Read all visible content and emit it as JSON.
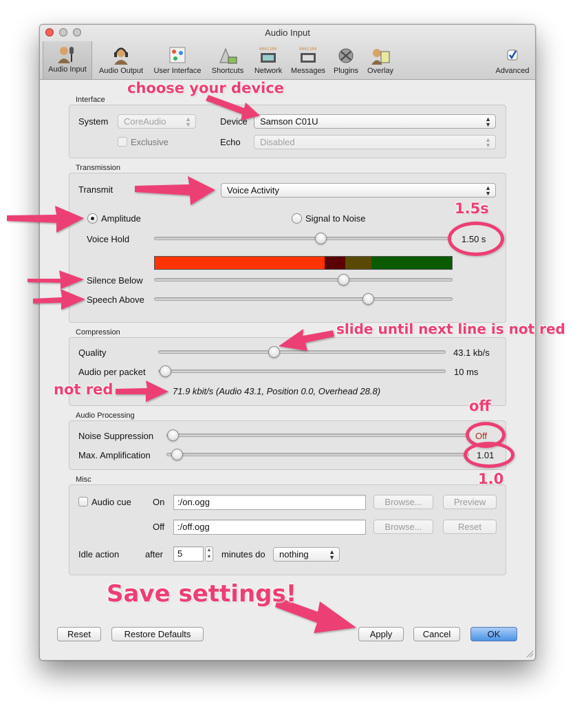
{
  "window": {
    "title": "Audio Input"
  },
  "toolbar": {
    "items": [
      {
        "label": "Audio Input",
        "icon": "microphone-person-icon"
      },
      {
        "label": "Audio Output",
        "icon": "headphones-person-icon"
      },
      {
        "label": "User Interface",
        "icon": "interface-icon"
      },
      {
        "label": "Shortcuts",
        "icon": "keyboard-icon"
      },
      {
        "label": "Network",
        "icon": "network-icon"
      },
      {
        "label": "Messages",
        "icon": "messages-icon"
      },
      {
        "label": "Plugins",
        "icon": "plugin-icon"
      },
      {
        "label": "Overlay",
        "icon": "overlay-icon"
      }
    ],
    "advanced_label": "Advanced",
    "advanced_checked": true
  },
  "interface": {
    "group_label": "Interface",
    "system_label": "System",
    "system_value": "CoreAudio",
    "exclusive_label": "Exclusive",
    "device_label": "Device",
    "device_value": "Samson C01U",
    "echo_label": "Echo",
    "echo_value": "Disabled"
  },
  "transmission": {
    "group_label": "Transmission",
    "transmit_label": "Transmit",
    "transmit_value": "Voice Activity",
    "amplitude_label": "Amplitude",
    "snr_label": "Signal to Noise",
    "voice_hold_label": "Voice Hold",
    "voice_hold_value": "1.50 s",
    "silence_below_label": "Silence Below",
    "speech_above_label": "Speech Above",
    "meter_colors": [
      "#ff3300",
      "#5a0000",
      "#5a4a00",
      "#0a5a00"
    ]
  },
  "compression": {
    "group_label": "Compression",
    "quality_label": "Quality",
    "quality_value": "43.1 kb/s",
    "audio_per_packet_label": "Audio per packet",
    "audio_per_packet_value": "10 ms",
    "bitrate_info": "71.9 kbit/s (Audio 43.1, Position 0.0, Overhead 28.8)"
  },
  "audio_processing": {
    "group_label": "Audio Processing",
    "noise_suppression_label": "Noise Suppression",
    "noise_suppression_value": "Off",
    "max_amp_label": "Max. Amplification",
    "max_amp_value": "1.01"
  },
  "misc": {
    "group_label": "Misc",
    "audio_cue_label": "Audio cue",
    "on_label": "On",
    "on_value": ":/on.ogg",
    "off_label": "Off",
    "off_value": ":/off.ogg",
    "browse_label": "Browse...",
    "preview_label": "Preview",
    "reset_label": "Reset",
    "idle_action_label": "Idle action",
    "after_label": "after",
    "idle_minutes": "5",
    "minutes_label": "minutes do",
    "idle_action_value": "nothing"
  },
  "footer": {
    "reset_label": "Reset",
    "restore_defaults_label": "Restore Defaults",
    "apply_label": "Apply",
    "cancel_label": "Cancel",
    "ok_label": "OK"
  },
  "annotations": {
    "choose_device": "choose your device",
    "voice_hold_hint": "1.5s",
    "slide_hint": "slide until next line is not red",
    "not_red": "not red",
    "off_hint": "off",
    "amp_hint": "1.0",
    "save_hint": "Save settings!",
    "color": "#ec3f74"
  }
}
